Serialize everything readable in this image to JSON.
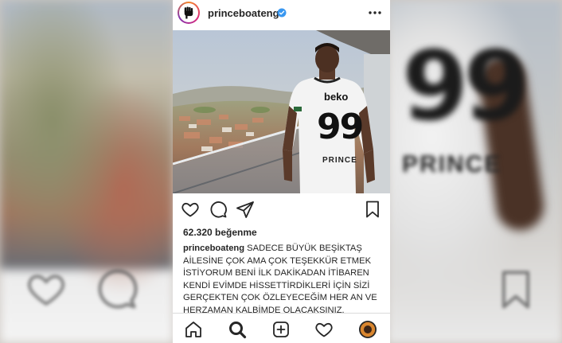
{
  "post": {
    "username": "princeboateng",
    "likes": "62.320 beğenme",
    "caption_user": "princeboateng",
    "caption_text": " SADECE BÜYÜK BEŞİKTAŞ AİLESİNE ÇOK AMA ÇOK TEŞEKKÜR ETMEK İSTİYORUM BENİ İLK DAKİKADAN İTİBAREN KENDİ EVİMDE HİSSETTİRDİKLERİ İÇİN SİZİ GERÇEKTEN ÇOK ÖZLEYECEĞİM HER AN VE HERZAMAN KALBİMDE OLACAKSINIZ."
  },
  "photo": {
    "jersey_sponsor": "beko",
    "jersey_number": "99",
    "jersey_name": "PRINCE"
  },
  "backdrop": {
    "number": "99",
    "name": "PRINCE"
  },
  "icons": {
    "header": [
      "avatar",
      "verified-badge-icon",
      "more-options-icon"
    ],
    "actions": [
      "heart-icon",
      "comment-icon",
      "share-icon",
      "bookmark-icon"
    ],
    "nav": [
      "home-icon",
      "search-icon",
      "new-post-icon",
      "activity-heart-icon",
      "profile-avatar-icon"
    ]
  },
  "colors": {
    "verified": "#3897f0",
    "text": "#262626",
    "divider": "#dbdbdb"
  }
}
